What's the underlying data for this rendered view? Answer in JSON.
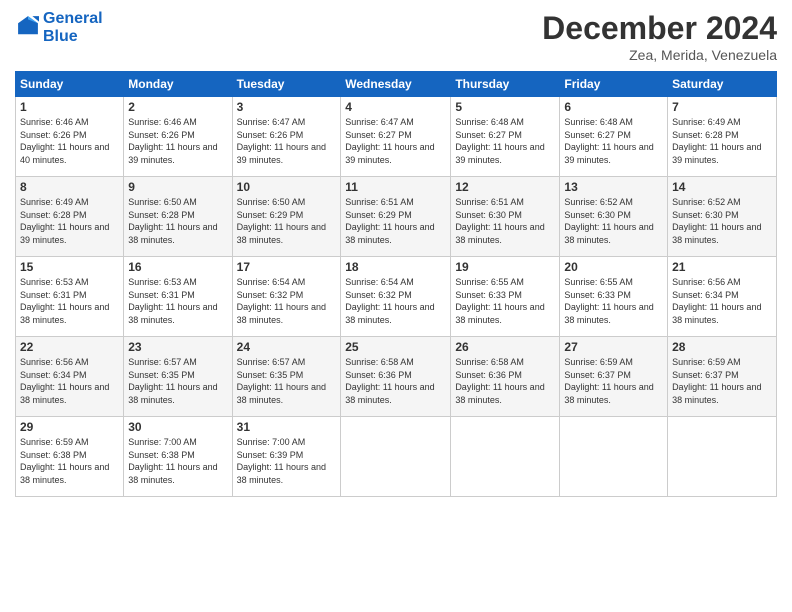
{
  "logo": {
    "line1": "General",
    "line2": "Blue"
  },
  "header": {
    "month": "December 2024",
    "location": "Zea, Merida, Venezuela"
  },
  "weekdays": [
    "Sunday",
    "Monday",
    "Tuesday",
    "Wednesday",
    "Thursday",
    "Friday",
    "Saturday"
  ],
  "weeks": [
    [
      {
        "day": "1",
        "sunrise": "6:46 AM",
        "sunset": "6:26 PM",
        "daylight": "11 hours and 40 minutes."
      },
      {
        "day": "2",
        "sunrise": "6:46 AM",
        "sunset": "6:26 PM",
        "daylight": "11 hours and 39 minutes."
      },
      {
        "day": "3",
        "sunrise": "6:47 AM",
        "sunset": "6:26 PM",
        "daylight": "11 hours and 39 minutes."
      },
      {
        "day": "4",
        "sunrise": "6:47 AM",
        "sunset": "6:27 PM",
        "daylight": "11 hours and 39 minutes."
      },
      {
        "day": "5",
        "sunrise": "6:48 AM",
        "sunset": "6:27 PM",
        "daylight": "11 hours and 39 minutes."
      },
      {
        "day": "6",
        "sunrise": "6:48 AM",
        "sunset": "6:27 PM",
        "daylight": "11 hours and 39 minutes."
      },
      {
        "day": "7",
        "sunrise": "6:49 AM",
        "sunset": "6:28 PM",
        "daylight": "11 hours and 39 minutes."
      }
    ],
    [
      {
        "day": "8",
        "sunrise": "6:49 AM",
        "sunset": "6:28 PM",
        "daylight": "11 hours and 39 minutes."
      },
      {
        "day": "9",
        "sunrise": "6:50 AM",
        "sunset": "6:28 PM",
        "daylight": "11 hours and 38 minutes."
      },
      {
        "day": "10",
        "sunrise": "6:50 AM",
        "sunset": "6:29 PM",
        "daylight": "11 hours and 38 minutes."
      },
      {
        "day": "11",
        "sunrise": "6:51 AM",
        "sunset": "6:29 PM",
        "daylight": "11 hours and 38 minutes."
      },
      {
        "day": "12",
        "sunrise": "6:51 AM",
        "sunset": "6:30 PM",
        "daylight": "11 hours and 38 minutes."
      },
      {
        "day": "13",
        "sunrise": "6:52 AM",
        "sunset": "6:30 PM",
        "daylight": "11 hours and 38 minutes."
      },
      {
        "day": "14",
        "sunrise": "6:52 AM",
        "sunset": "6:30 PM",
        "daylight": "11 hours and 38 minutes."
      }
    ],
    [
      {
        "day": "15",
        "sunrise": "6:53 AM",
        "sunset": "6:31 PM",
        "daylight": "11 hours and 38 minutes."
      },
      {
        "day": "16",
        "sunrise": "6:53 AM",
        "sunset": "6:31 PM",
        "daylight": "11 hours and 38 minutes."
      },
      {
        "day": "17",
        "sunrise": "6:54 AM",
        "sunset": "6:32 PM",
        "daylight": "11 hours and 38 minutes."
      },
      {
        "day": "18",
        "sunrise": "6:54 AM",
        "sunset": "6:32 PM",
        "daylight": "11 hours and 38 minutes."
      },
      {
        "day": "19",
        "sunrise": "6:55 AM",
        "sunset": "6:33 PM",
        "daylight": "11 hours and 38 minutes."
      },
      {
        "day": "20",
        "sunrise": "6:55 AM",
        "sunset": "6:33 PM",
        "daylight": "11 hours and 38 minutes."
      },
      {
        "day": "21",
        "sunrise": "6:56 AM",
        "sunset": "6:34 PM",
        "daylight": "11 hours and 38 minutes."
      }
    ],
    [
      {
        "day": "22",
        "sunrise": "6:56 AM",
        "sunset": "6:34 PM",
        "daylight": "11 hours and 38 minutes."
      },
      {
        "day": "23",
        "sunrise": "6:57 AM",
        "sunset": "6:35 PM",
        "daylight": "11 hours and 38 minutes."
      },
      {
        "day": "24",
        "sunrise": "6:57 AM",
        "sunset": "6:35 PM",
        "daylight": "11 hours and 38 minutes."
      },
      {
        "day": "25",
        "sunrise": "6:58 AM",
        "sunset": "6:36 PM",
        "daylight": "11 hours and 38 minutes."
      },
      {
        "day": "26",
        "sunrise": "6:58 AM",
        "sunset": "6:36 PM",
        "daylight": "11 hours and 38 minutes."
      },
      {
        "day": "27",
        "sunrise": "6:59 AM",
        "sunset": "6:37 PM",
        "daylight": "11 hours and 38 minutes."
      },
      {
        "day": "28",
        "sunrise": "6:59 AM",
        "sunset": "6:37 PM",
        "daylight": "11 hours and 38 minutes."
      }
    ],
    [
      {
        "day": "29",
        "sunrise": "6:59 AM",
        "sunset": "6:38 PM",
        "daylight": "11 hours and 38 minutes."
      },
      {
        "day": "30",
        "sunrise": "7:00 AM",
        "sunset": "6:38 PM",
        "daylight": "11 hours and 38 minutes."
      },
      {
        "day": "31",
        "sunrise": "7:00 AM",
        "sunset": "6:39 PM",
        "daylight": "11 hours and 38 minutes."
      },
      null,
      null,
      null,
      null
    ]
  ]
}
